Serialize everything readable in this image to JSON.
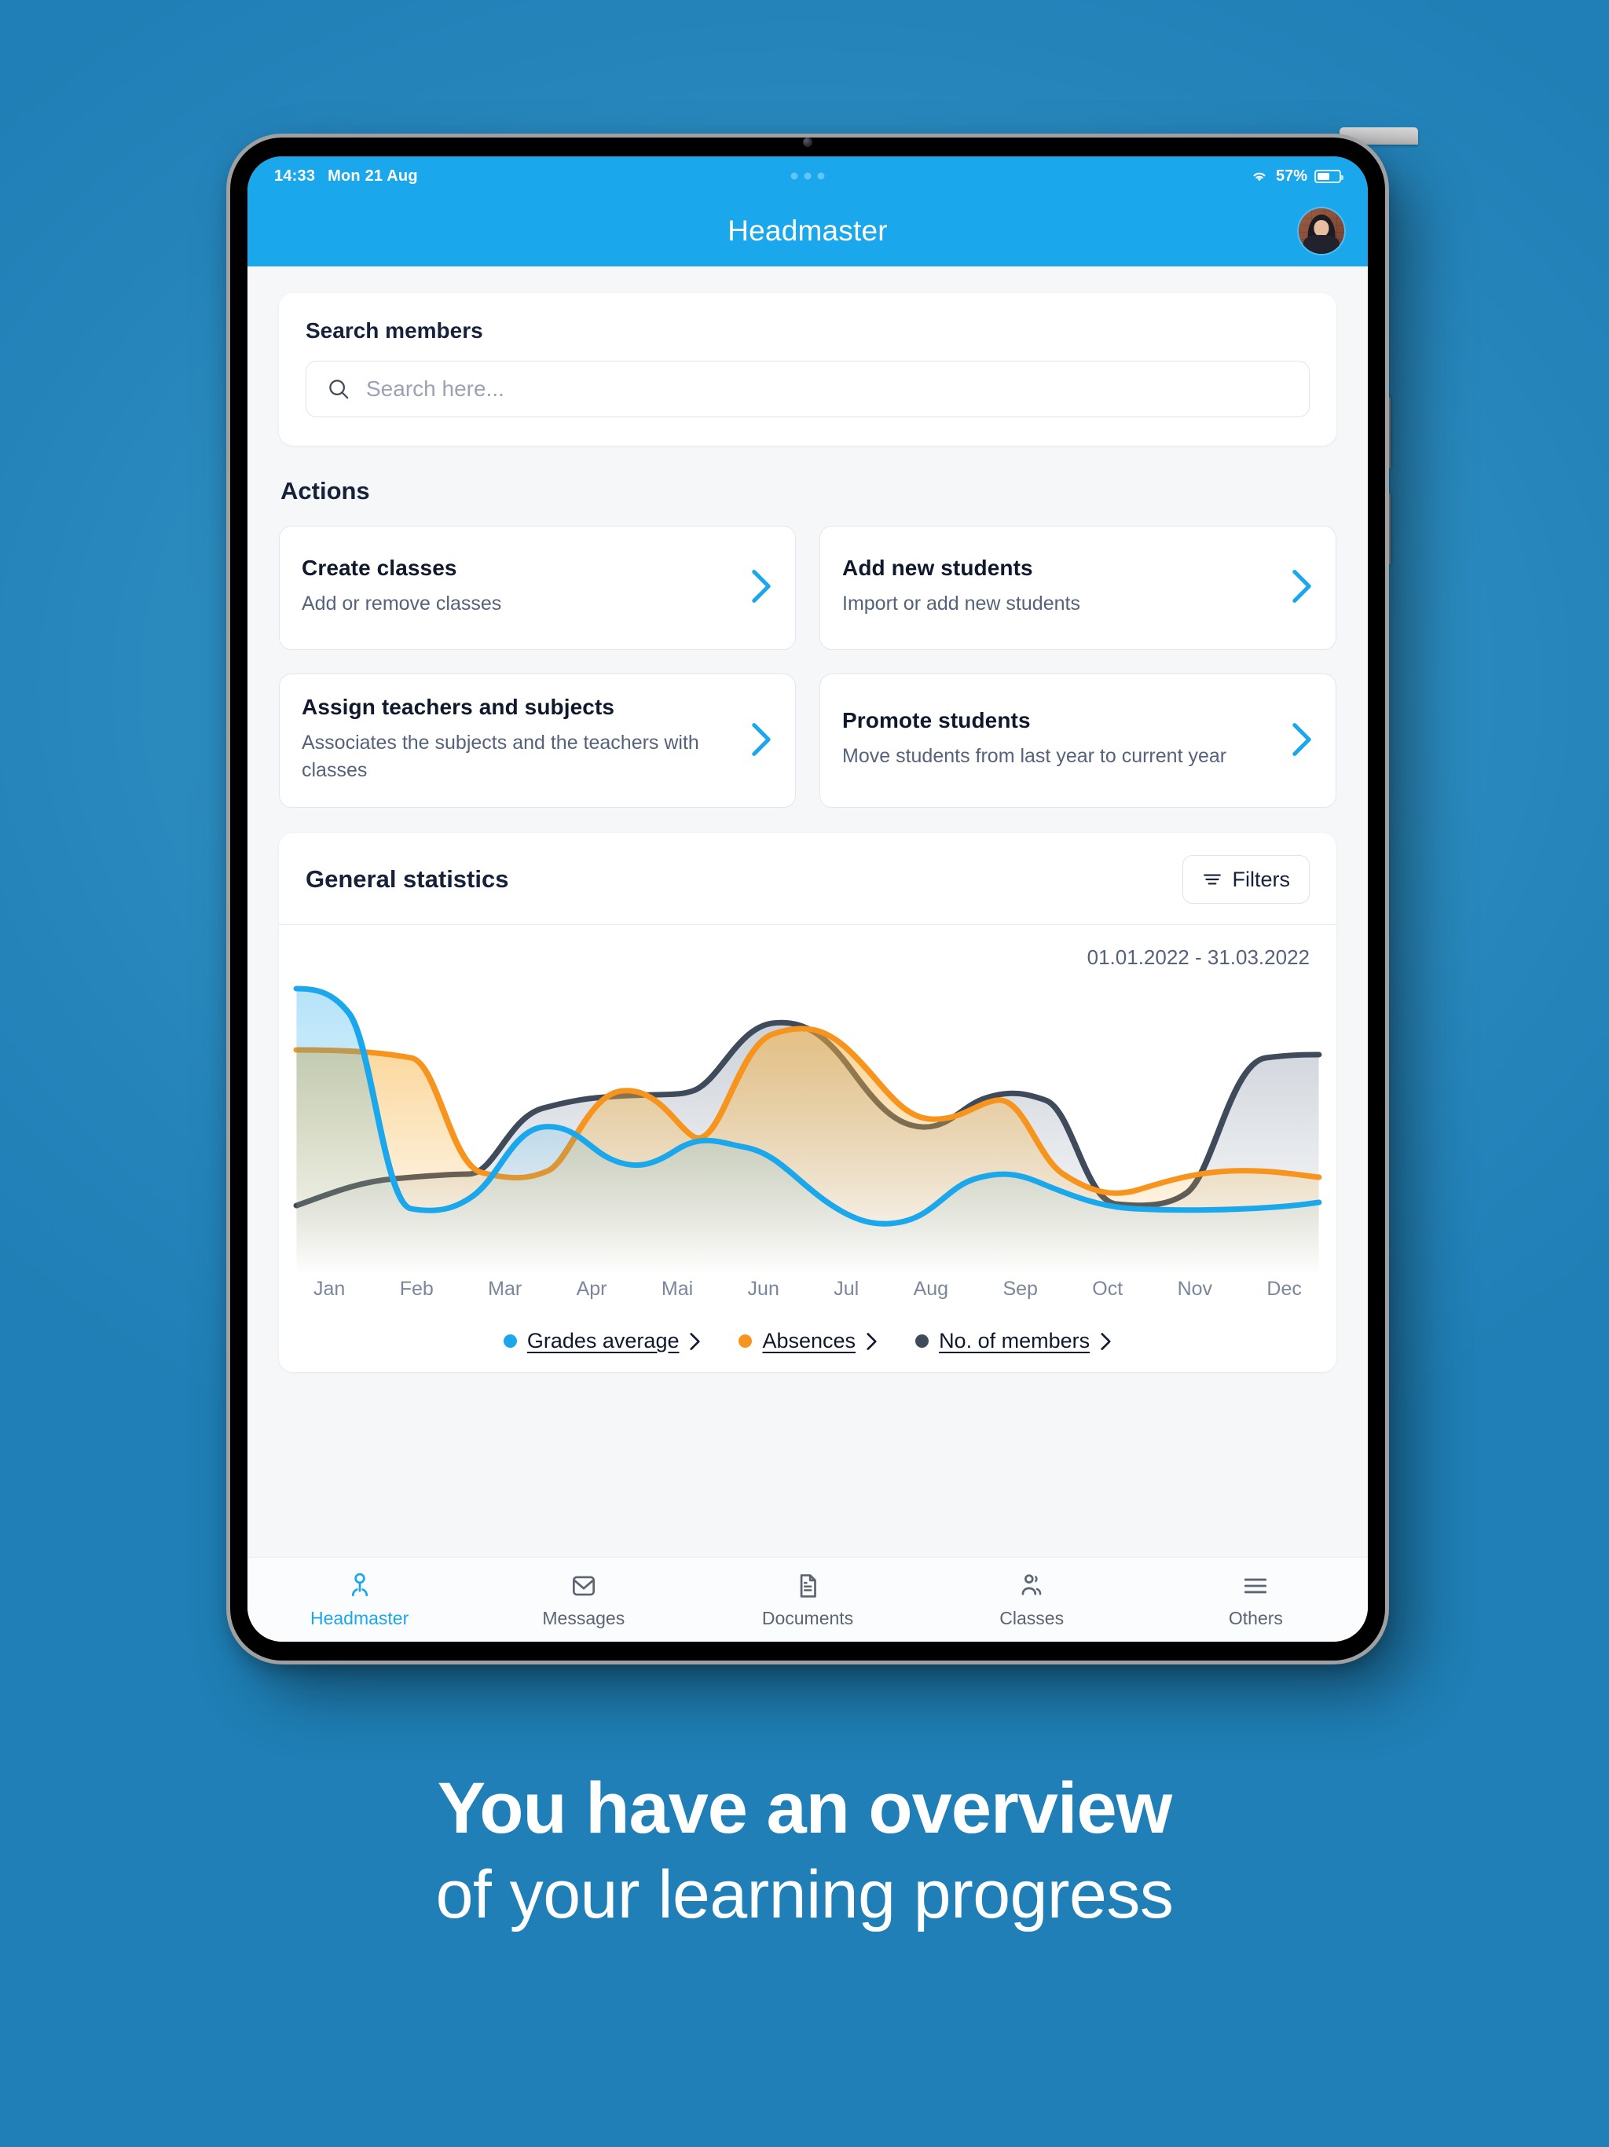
{
  "statusbar": {
    "time": "14:33",
    "date": "Mon 21 Aug",
    "battery_percent": "57%",
    "wifi_icon": "wifi-icon",
    "battery_icon": "battery-icon"
  },
  "navbar": {
    "title": "Headmaster",
    "avatar_icon": "user-avatar"
  },
  "search": {
    "label": "Search members",
    "placeholder": "Search here...",
    "value": "",
    "icon": "search-icon"
  },
  "actions": {
    "section_title": "Actions",
    "items": [
      {
        "title": "Create classes",
        "subtitle": "Add or remove classes",
        "chevron": "chevron-right-icon"
      },
      {
        "title": "Add new students",
        "subtitle": "Import or add new students",
        "chevron": "chevron-right-icon"
      },
      {
        "title": "Assign teachers and subjects",
        "subtitle": "Associates the subjects and the teachers with classes",
        "chevron": "chevron-right-icon"
      },
      {
        "title": "Promote students",
        "subtitle": "Move students from last year to current year",
        "chevron": "chevron-right-icon"
      }
    ]
  },
  "statistics": {
    "title": "General statistics",
    "filters_label": "Filters",
    "filters_icon": "filter-icon",
    "date_range": "01.01.2022 - 31.03.2022"
  },
  "chart_data": {
    "type": "area",
    "title": "General statistics",
    "subtitle": "01.01.2022 - 31.03.2022",
    "xlabel": "",
    "ylabel": "",
    "grid": false,
    "legend_position": "bottom",
    "categories": [
      "Jan",
      "Feb",
      "Mar",
      "Apr",
      "Mai",
      "Jun",
      "Jul",
      "Aug",
      "Sep",
      "Oct",
      "Nov",
      "Dec"
    ],
    "ylim": [
      0,
      100
    ],
    "series": [
      {
        "name": "Grades average",
        "color": "#1aa7ec",
        "values": [
          96,
          88,
          30,
          22,
          47,
          52,
          40,
          44,
          48,
          38,
          14,
          22,
          26
        ]
      },
      {
        "name": "Absences",
        "color": "#f7941d",
        "values": [
          79,
          77,
          32,
          27,
          59,
          53,
          62,
          88,
          90,
          70,
          54,
          63,
          29,
          27
        ]
      },
      {
        "name": "No. of members",
        "color": "#3f4a5a",
        "values": [
          24,
          28,
          33,
          33,
          57,
          60,
          61,
          86,
          83,
          61,
          52,
          60,
          58,
          24,
          26,
          71,
          73
        ]
      }
    ]
  },
  "legend": [
    {
      "label": "Grades average",
      "color": "#1aa7ec",
      "chevron": "chevron-right-icon"
    },
    {
      "label": "Absences",
      "color": "#f7941d",
      "chevron": "chevron-right-icon"
    },
    {
      "label": "No. of members",
      "color": "#3f4a5a",
      "chevron": "chevron-right-icon"
    }
  ],
  "tabbar": {
    "items": [
      {
        "label": "Headmaster",
        "icon": "person-headmaster-icon",
        "active": true
      },
      {
        "label": "Messages",
        "icon": "envelope-icon",
        "active": false
      },
      {
        "label": "Documents",
        "icon": "document-icon",
        "active": false
      },
      {
        "label": "Classes",
        "icon": "people-group-icon",
        "active": false
      },
      {
        "label": "Others",
        "icon": "hamburger-menu-icon",
        "active": false
      }
    ]
  },
  "caption": {
    "line1": "You have an overview",
    "line2": "of your learning progress"
  },
  "colors": {
    "brand_blue": "#1aa7ec",
    "background_blue": "#2a8bc4",
    "orange": "#f7941d",
    "dark_slate": "#3f4a5a",
    "text_dark": "#16213a",
    "text_muted": "#56627a"
  }
}
